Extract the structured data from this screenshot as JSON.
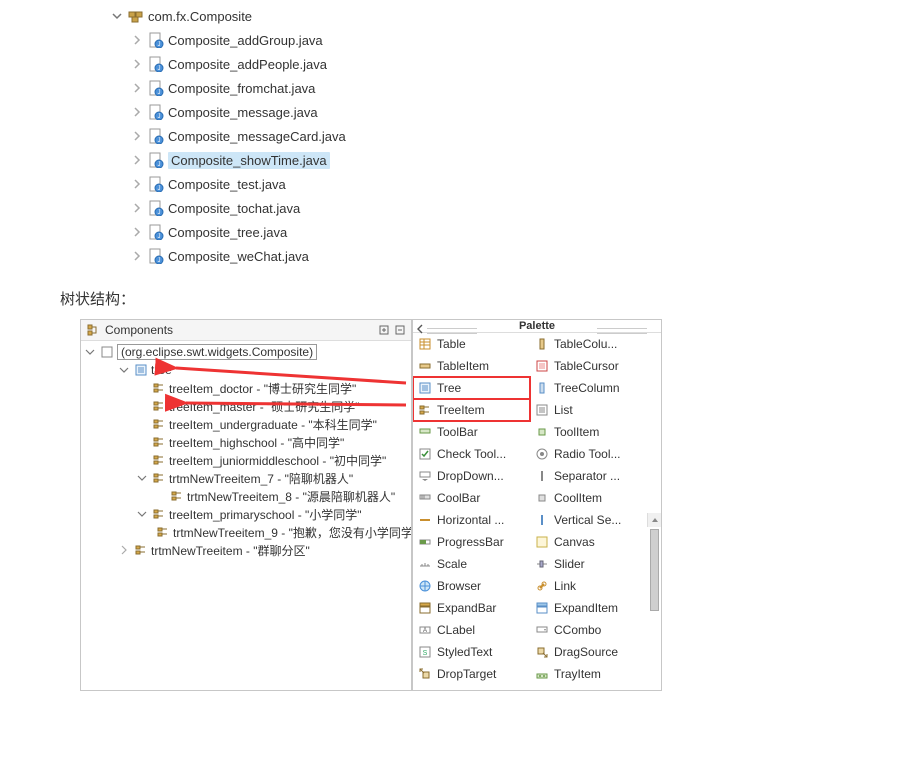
{
  "package_explorer": {
    "package_label": "com.fx.Composite",
    "files": [
      {
        "name": "Composite_addGroup.java",
        "selected": false
      },
      {
        "name": "Composite_addPeople.java",
        "selected": false
      },
      {
        "name": "Composite_fromchat.java",
        "selected": false
      },
      {
        "name": "Composite_message.java",
        "selected": false
      },
      {
        "name": "Composite_messageCard.java",
        "selected": false
      },
      {
        "name": "Composite_showTime.java",
        "selected": true
      },
      {
        "name": "Composite_test.java",
        "selected": false
      },
      {
        "name": "Composite_tochat.java",
        "selected": false
      },
      {
        "name": "Composite_tree.java",
        "selected": false
      },
      {
        "name": "Composite_weChat.java",
        "selected": false
      }
    ]
  },
  "section_heading": "树状结构：",
  "components_panel": {
    "title": "Components",
    "root_label": "(org.eclipse.swt.widgets.Composite)",
    "items": [
      {
        "level": 2,
        "expand": "open",
        "icon": "tree",
        "label": "tree"
      },
      {
        "level": 3,
        "expand": "none",
        "icon": "treeitem",
        "label": "treeItem_doctor - \"博士研究生同学\""
      },
      {
        "level": 3,
        "expand": "none",
        "icon": "treeitem",
        "label": "treeItem_master - \"硕士研究生同学\""
      },
      {
        "level": 3,
        "expand": "none",
        "icon": "treeitem",
        "label": "treeItem_undergraduate - \"本科生同学\""
      },
      {
        "level": 3,
        "expand": "none",
        "icon": "treeitem",
        "label": "treeItem_highschool - \"高中同学\""
      },
      {
        "level": 3,
        "expand": "none",
        "icon": "treeitem",
        "label": "treeItem_juniormiddleschool - \"初中同学\""
      },
      {
        "level": 3,
        "expand": "open",
        "icon": "treeitem",
        "label": "trtmNewTreeitem_7 - \"陪聊机器人\""
      },
      {
        "level": 4,
        "expand": "none",
        "icon": "treeitem",
        "label": "trtmNewTreeitem_8 - \"源晨陪聊机器人\""
      },
      {
        "level": 3,
        "expand": "open",
        "icon": "treeitem",
        "label": "treeItem_primaryschool - \"小学同学\""
      },
      {
        "level": 4,
        "expand": "none",
        "icon": "treeitem",
        "label": "trtmNewTreeitem_9 - \"抱歉，您没有小学同学\""
      },
      {
        "level": 2,
        "expand": "closed",
        "icon": "treeitem",
        "label": "trtmNewTreeitem - \"群聊分区\""
      }
    ]
  },
  "palette": {
    "title": "Palette",
    "items": [
      {
        "icon": "table",
        "label": "Table"
      },
      {
        "icon": "tablecol",
        "label": "TableColu..."
      },
      {
        "icon": "tableitem",
        "label": "TableItem"
      },
      {
        "icon": "tablecur",
        "label": "TableCursor"
      },
      {
        "icon": "tree",
        "label": "Tree",
        "highlight": true
      },
      {
        "icon": "treecol",
        "label": "TreeColumn"
      },
      {
        "icon": "treeitem",
        "label": "TreeItem",
        "highlight": true
      },
      {
        "icon": "list",
        "label": "List"
      },
      {
        "icon": "toolbar",
        "label": "ToolBar"
      },
      {
        "icon": "toolitem",
        "label": "ToolItem"
      },
      {
        "icon": "check",
        "label": "Check Tool..."
      },
      {
        "icon": "radio",
        "label": "Radio Tool..."
      },
      {
        "icon": "dropdown",
        "label": "DropDown..."
      },
      {
        "icon": "separator",
        "label": "Separator ..."
      },
      {
        "icon": "coolbar",
        "label": "CoolBar"
      },
      {
        "icon": "coolitem",
        "label": "CoolItem"
      },
      {
        "icon": "hline",
        "label": "Horizontal ..."
      },
      {
        "icon": "vline",
        "label": "Vertical Se..."
      },
      {
        "icon": "progress",
        "label": "ProgressBar"
      },
      {
        "icon": "canvas",
        "label": "Canvas"
      },
      {
        "icon": "scale",
        "label": "Scale"
      },
      {
        "icon": "slider",
        "label": "Slider"
      },
      {
        "icon": "browser",
        "label": "Browser"
      },
      {
        "icon": "link",
        "label": "Link"
      },
      {
        "icon": "expandbar",
        "label": "ExpandBar"
      },
      {
        "icon": "expanditem",
        "label": "ExpandItem"
      },
      {
        "icon": "clabel",
        "label": "CLabel"
      },
      {
        "icon": "ccombo",
        "label": "CCombo"
      },
      {
        "icon": "styled",
        "label": "StyledText"
      },
      {
        "icon": "drag",
        "label": "DragSource"
      },
      {
        "icon": "drop",
        "label": "DropTarget"
      },
      {
        "icon": "tray",
        "label": "TrayItem"
      }
    ]
  }
}
